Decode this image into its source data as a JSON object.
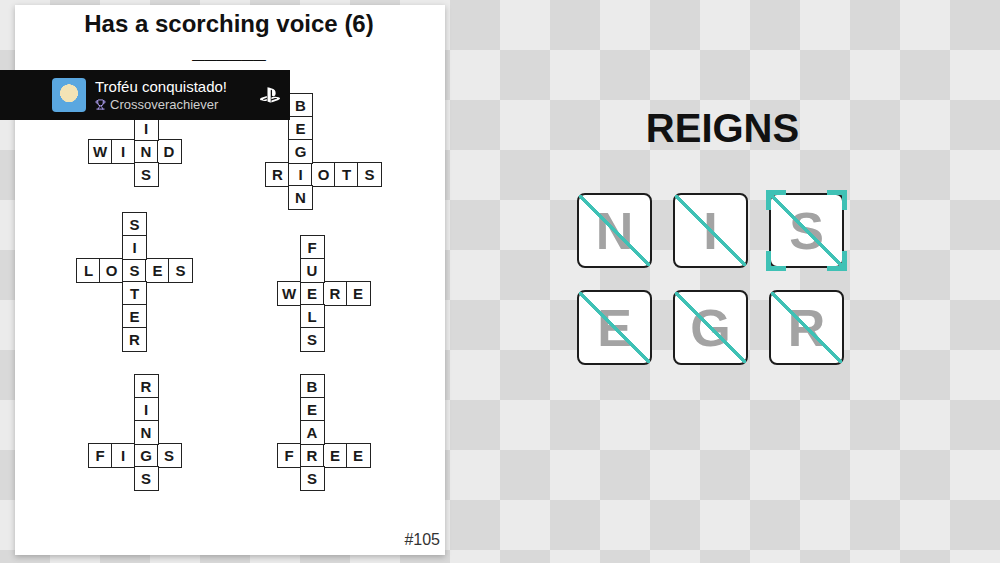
{
  "notification": {
    "title": "Troféu conquistado!",
    "trophy": "Crossoverachiever"
  },
  "clue": {
    "text": "Has a scorching voice (6)",
    "blanks": "______"
  },
  "puzzles": [
    {
      "across": "WIND",
      "across_index": 2,
      "down": [
        "",
        "I",
        "N",
        "S"
      ],
      "down_index": 2
    },
    {
      "across": "RIOTS",
      "across_index": 1,
      "down": [
        "B",
        "E",
        "G",
        "I",
        "N"
      ],
      "down_index": 3
    },
    {
      "across": "LOSES",
      "across_index": 2,
      "down": [
        "S",
        "I",
        "S",
        "T",
        "E",
        "R"
      ],
      "down_index": 2
    },
    {
      "across": "WERE",
      "across_index": 1,
      "down": [
        "F",
        "U",
        "E",
        "L",
        "S"
      ],
      "down_index": 2
    },
    {
      "across": "FIGS",
      "across_index": 2,
      "down": [
        "R",
        "I",
        "N",
        "G",
        "S"
      ],
      "down_index": 3
    },
    {
      "across": "FREE",
      "across_index": 1,
      "down": [
        "B",
        "E",
        "A",
        "R",
        "S"
      ],
      "down_index": 3
    }
  ],
  "puzzle_number": "#105",
  "word": "REIGNS",
  "tiles": [
    {
      "letter": "N",
      "struck": true,
      "selected": false
    },
    {
      "letter": "I",
      "struck": true,
      "selected": false
    },
    {
      "letter": "S",
      "struck": true,
      "selected": true
    },
    {
      "letter": "E",
      "struck": true,
      "selected": false
    },
    {
      "letter": "G",
      "struck": true,
      "selected": false
    },
    {
      "letter": "R",
      "struck": true,
      "selected": false
    }
  ]
}
